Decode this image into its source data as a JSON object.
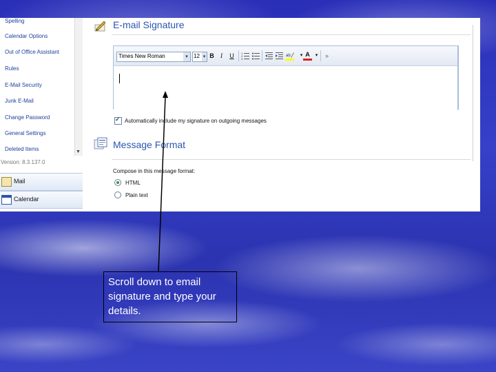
{
  "nav": {
    "options": [
      "Spelling",
      "Calendar Options",
      "Out of Office Assistant",
      "Rules",
      "E-Mail Security",
      "Junk E-Mail",
      "Change Password",
      "General Settings",
      "Deleted Items"
    ],
    "version": "Version: 8.3.137.0",
    "buttons": [
      {
        "label": "Mail",
        "icon": "mail-icon"
      },
      {
        "label": "Calendar",
        "icon": "calendar-icon"
      }
    ]
  },
  "signature": {
    "title": "E-mail Signature",
    "font": "Times New Roman",
    "size": "12",
    "toolbar": {
      "bold": "B",
      "italic": "I",
      "underline": "U",
      "font_color": "A",
      "more": "»"
    },
    "auto_include_label": "Automatically include my signature on outgoing messages",
    "auto_include_checked": true
  },
  "message_format": {
    "title": "Message Format",
    "compose_label": "Compose in this message format:",
    "options": [
      "HTML",
      "Plain text"
    ],
    "selected": "HTML"
  },
  "callout": {
    "text": "Scroll down to email signature and type your details."
  },
  "colors": {
    "accent": "#2a57b0",
    "background": "#2f37bd"
  }
}
